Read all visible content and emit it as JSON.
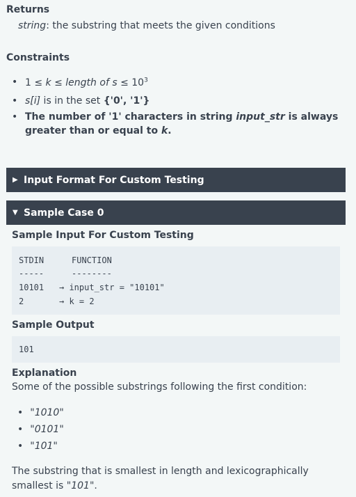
{
  "returns": {
    "heading": "Returns",
    "type": "string",
    "description": ": the substring that meets the given conditions"
  },
  "constraints": {
    "heading": "Constraints",
    "c1_prefix": "1 ≤ ",
    "c1_k": "k",
    "c1_mid": " ≤ ",
    "c1_len": "length of s",
    "c1_le": " ≤ 10",
    "c1_exp": "3",
    "c2_var": "s[i]",
    "c2_mid": " is in the set ",
    "c2_set": "{'0', '1'}",
    "c3_a": "The number of '1' characters in string ",
    "c3_var": "input_str",
    "c3_b": " is always greater than or equal to ",
    "c3_k": "k",
    "c3_end": "."
  },
  "sections": {
    "input_format": "Input Format For Custom Testing",
    "sample_case": "Sample Case 0"
  },
  "sample_input": {
    "heading": "Sample Input For Custom Testing",
    "header_left": "STDIN",
    "header_right": "FUNCTION",
    "rule_left": "-----",
    "rule_right": "--------",
    "row1_left": "10101",
    "row1_right": "→ input_str = \"10101\"",
    "row2_left": "2",
    "row2_right": "→ k = 2"
  },
  "sample_output": {
    "heading": "Sample Output",
    "value": "101"
  },
  "explanation": {
    "heading": "Explanation",
    "intro": "Some of the possible substrings following the first condition:",
    "items": [
      "\"1010\"",
      "\"0101\"",
      "\"101\""
    ],
    "conclusion_a": "The substring that is smallest in length and lexicographically smallest is ",
    "conclusion_val": "\"101\"",
    "conclusion_end": "."
  }
}
